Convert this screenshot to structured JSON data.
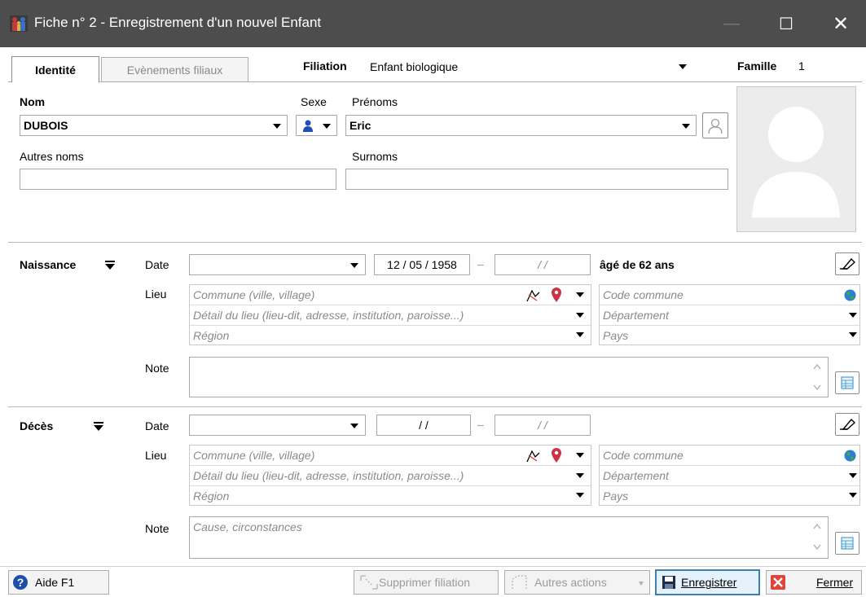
{
  "window": {
    "title": "Fiche n° 2  -  Enregistrement d'un nouvel Enfant",
    "minimize": "—",
    "maximize": "☐",
    "close": "✕"
  },
  "tabs": [
    {
      "label": "Identité",
      "active": true
    },
    {
      "label": "Evènements filiaux",
      "active": false
    }
  ],
  "filiation": {
    "label": "Filiation",
    "value": "Enfant biologique"
  },
  "famille": {
    "label": "Famille",
    "value": "1"
  },
  "identity": {
    "nom_label": "Nom",
    "nom_value": "DUBOIS",
    "sexe_label": "Sexe",
    "prenoms_label": "Prénoms",
    "prenoms_value": "Eric",
    "autres_noms_label": "Autres noms",
    "autres_noms_value": "",
    "surnoms_label": "Surnoms",
    "surnoms_value": ""
  },
  "naissance": {
    "title": "Naissance",
    "date_label": "Date",
    "date_qualifier": "",
    "date1": "12 / 05 / 1958",
    "date2": "/  /",
    "age": "âgé de 62 ans",
    "lieu_label": "Lieu",
    "commune_ph": "Commune (ville, village)",
    "detail_ph": "Détail du lieu (lieu-dit, adresse, institution, paroisse...)",
    "region_ph": "Région",
    "code_commune_ph": "Code commune",
    "departement_ph": "Département",
    "pays_ph": "Pays",
    "note_label": "Note",
    "note_value": ""
  },
  "deces": {
    "title": "Décès",
    "date_label": "Date",
    "date1": "/  /",
    "date2": "/  /",
    "lieu_label": "Lieu",
    "commune_ph": "Commune (ville, village)",
    "detail_ph": "Détail du lieu (lieu-dit, adresse, institution, paroisse...)",
    "region_ph": "Région",
    "code_commune_ph": "Code commune",
    "departement_ph": "Département",
    "pays_ph": "Pays",
    "note_label": "Note",
    "note_ph": "Cause, circonstances"
  },
  "footer": {
    "help": "Aide  F1",
    "supprimer": "Supprimer filiation",
    "autres_actions": "Autres actions",
    "enregistrer": "Enregistrer",
    "fermer": "Fermer"
  },
  "colors": {
    "titlebar": "#4d4d4d",
    "accent": "#3c7fb1",
    "close_red": "#e0443a"
  }
}
